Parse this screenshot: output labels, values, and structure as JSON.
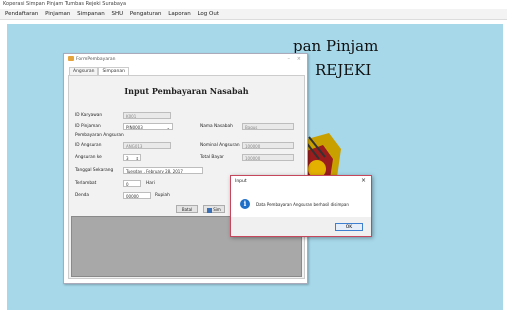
{
  "window": {
    "title": "Koperasi Simpan Pinjam Tumbas Rejeki Surabaya"
  },
  "menu": [
    "Pendaftaran",
    "Pinjaman",
    "Simpanan",
    "SHU",
    "Pengaturan",
    "Laporan",
    "Log Out"
  ],
  "background": {
    "title_line1": "pan Pinjam",
    "title_line2": "REJEKI"
  },
  "child": {
    "title": "FormPembayaran",
    "controls": {
      "minimize": "–",
      "close": "×"
    },
    "tabs": [
      "Angsuran",
      "Simpanan"
    ],
    "heading": "Input Pembayaran Nasabah",
    "fields": {
      "id_karyawan": {
        "label": "ID Karyawan",
        "value": "K001"
      },
      "id_pinjaman": {
        "label": "ID Pinjaman",
        "value": "PIN0003"
      },
      "nama_nasabah": {
        "label": "Nama Nasabah",
        "value": "Bagus"
      },
      "section_label": "Pembayaran Angsuran",
      "id_angsuran": {
        "label": "ID Angsuran",
        "value": "ANG013"
      },
      "nominal_angsuran": {
        "label": "Nominal Angsuran",
        "value": "100000"
      },
      "angsuran_ke": {
        "label": "Angsuran ke",
        "value": "3"
      },
      "total_bayar": {
        "label": "Total Bayar",
        "value": "100000"
      },
      "tanggal_sekarang": {
        "label": "Tanggal Sekarang",
        "value": "Tuesday , February 28, 2017"
      },
      "terlambat": {
        "label": "Terlambat",
        "value": "0",
        "unit": "Hari"
      },
      "denda": {
        "label": "Denda",
        "value": "00000",
        "unit": "Rupiah"
      }
    },
    "buttons": {
      "batal": "Batal",
      "simpan": "Sim"
    }
  },
  "dialog": {
    "title": "Input",
    "message": "Data Pembayaran Angsuran berhasil disimpan",
    "ok_label": "OK",
    "close": "×"
  },
  "colors": {
    "desktop_bg": "#a6d8ea",
    "info_icon": "#1f6fc8",
    "dialog_border": "#c6475b"
  }
}
